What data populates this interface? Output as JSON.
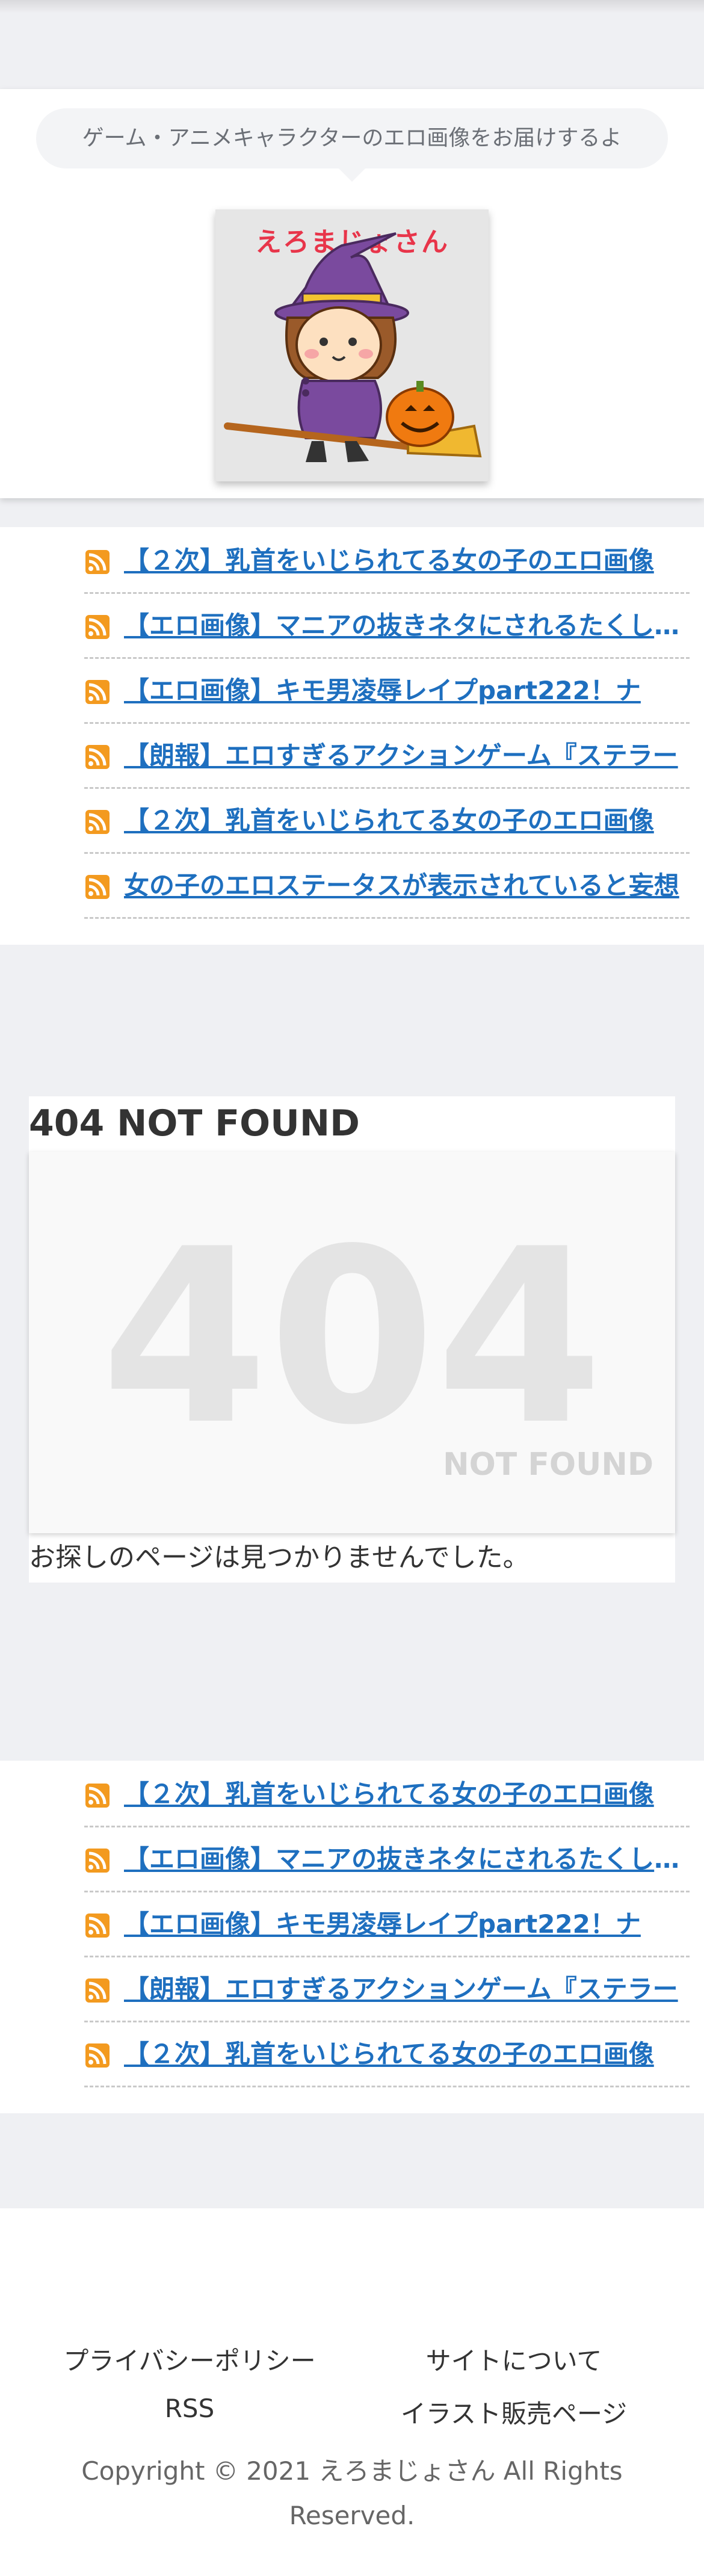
{
  "header": {
    "tagline": "ゲーム・アニメキャラクターのエロ画像をお届けするよ",
    "logo_text": "えろまじょさん"
  },
  "top_list": [
    {
      "label": "【２次】乳首をいじられてる女の子のエロ画像"
    },
    {
      "label": "【エロ画像】マニアの抜きネタにされるたくしあげ"
    },
    {
      "label": "【エロ画像】キモ男凌辱レイプpart222！ナ"
    },
    {
      "label": "【朗報】エロすぎるアクションゲーム『ステラー"
    },
    {
      "label": "【２次】乳首をいじられてる女の子のエロ画像"
    },
    {
      "label": "女の子のエロステータスが表示されていると妄想"
    }
  ],
  "article": {
    "title": "404 NOT FOUND",
    "image_big": "404",
    "image_small": "NOT FOUND",
    "message": "お探しのページは見つかりませんでした。"
  },
  "bottom_list": [
    {
      "label": "【２次】乳首をいじられてる女の子のエロ画像"
    },
    {
      "label": "【エロ画像】マニアの抜きネタにされるたくしあげ"
    },
    {
      "label": "【エロ画像】キモ男凌辱レイプpart222！ナ"
    },
    {
      "label": "【朗報】エロすぎるアクションゲーム『ステラー"
    },
    {
      "label": "【２次】乳首をいじられてる女の子のエロ画像"
    }
  ],
  "footer": {
    "privacy": "プライバシーポリシー",
    "about": "サイトについて",
    "rss": "RSS",
    "illust": "イラスト販売ページ",
    "copyright": "Copyright © 2021 えろまじょさん All Rights Reserved."
  },
  "colors": {
    "link": "#1e6fbf",
    "rss": "#f39a1f",
    "page_bg": "#eff0f3"
  }
}
